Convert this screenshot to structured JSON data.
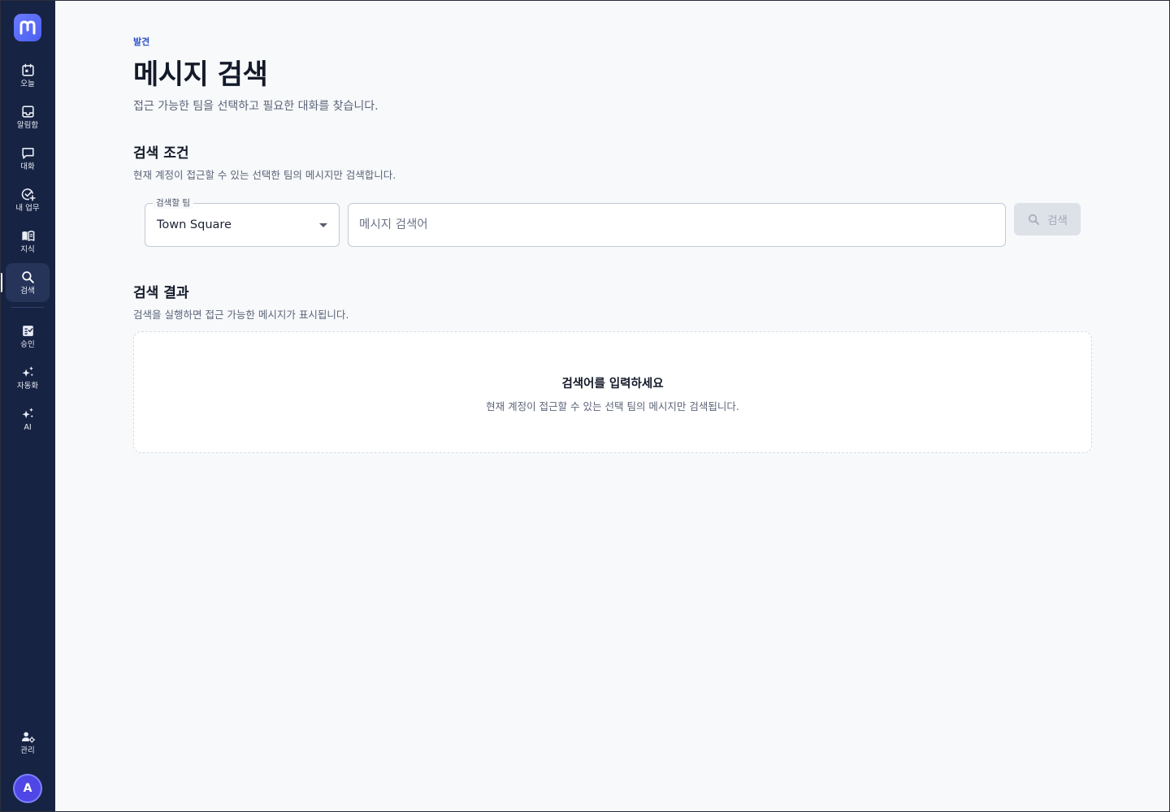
{
  "sidebar": {
    "logo_letter": "m",
    "items": [
      {
        "label": "오늘",
        "icon": "calendar-icon"
      },
      {
        "label": "알림함",
        "icon": "inbox-icon"
      },
      {
        "label": "대화",
        "icon": "chat-bubble-icon"
      },
      {
        "label": "내 업무",
        "icon": "check-plus-icon"
      },
      {
        "label": "지식",
        "icon": "book-icon"
      },
      {
        "label": "검색",
        "icon": "search-icon",
        "active": true
      },
      {
        "label": "승인",
        "icon": "approval-icon"
      },
      {
        "label": "자동화",
        "icon": "sparkle-icon"
      },
      {
        "label": "AI",
        "icon": "sparkle-icon"
      }
    ],
    "admin_label": "관리",
    "avatar_initial": "A"
  },
  "page": {
    "eyebrow": "발견",
    "title": "메시지 검색",
    "subtitle": "접근 가능한 팀을 선택하고 필요한 대화를 찾습니다."
  },
  "criteria": {
    "title": "검색 조건",
    "description": "현재 계정이 접근할 수 있는 선택한 팀의 메시지만 검색합니다.",
    "team_field_label": "검색할 팀",
    "team_value": "Town Square",
    "search_placeholder": "메시지 검색어",
    "search_value": "",
    "search_button_label": "검색"
  },
  "results": {
    "title": "검색 결과",
    "description": "검색을 실행하면 접근 가능한 메시지가 표시됩니다.",
    "empty_title": "검색어를 입력하세요",
    "empty_description": "현재 계정이 접근할 수 있는 선택 팀의 메시지만 검색됩니다."
  },
  "colors": {
    "sidebar_bg": "#172343",
    "accent": "#2f54c9",
    "logo": "#5b6cf8",
    "avatar": "#4f46e5"
  }
}
